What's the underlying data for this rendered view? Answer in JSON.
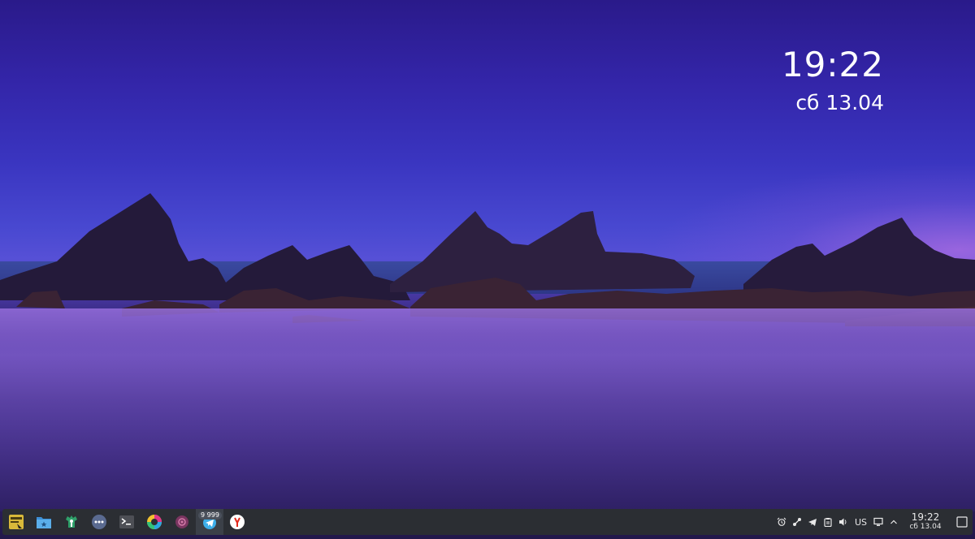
{
  "desktop": {
    "clock_widget": {
      "time": "19:22",
      "date": "сб 13.04"
    }
  },
  "taskbar": {
    "launchers": [
      {
        "name": "base-alt-launcher-icon"
      },
      {
        "name": "file-manager-icon"
      },
      {
        "name": "settings-manager-icon"
      },
      {
        "name": "more-apps-icon"
      },
      {
        "name": "terminal-icon"
      },
      {
        "name": "color-picker-icon"
      },
      {
        "name": "app-icon"
      },
      {
        "name": "telegram-icon",
        "badge": "9 999"
      },
      {
        "name": "yandex-browser-icon"
      }
    ],
    "tray": {
      "language": "US",
      "time": "19:22",
      "date": "сб 13.04"
    }
  },
  "colors": {
    "taskbar_bg": "#2b2e33",
    "accent_blue": "#3daee9"
  }
}
